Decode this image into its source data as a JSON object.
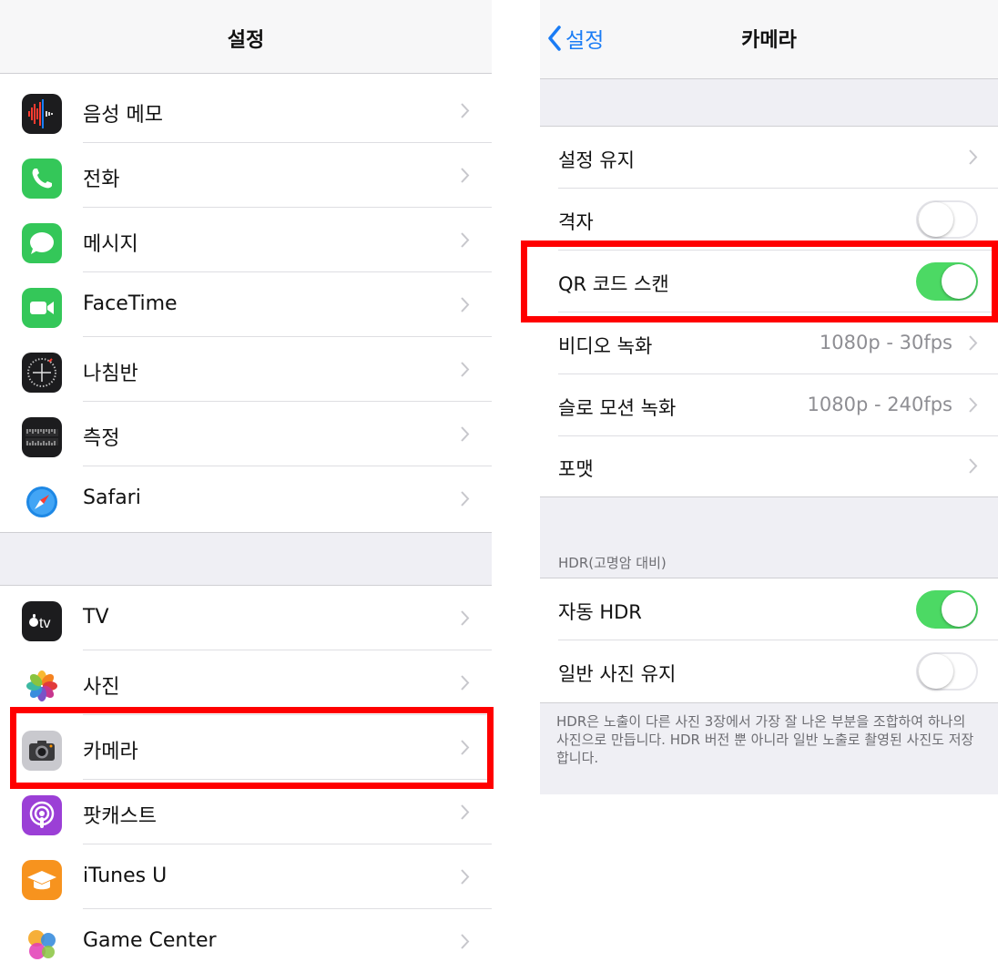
{
  "left": {
    "title": "설정",
    "group1": [
      {
        "label": "음성 메모",
        "icon": "voice-memos-icon"
      },
      {
        "label": "전화",
        "icon": "phone-icon"
      },
      {
        "label": "메시지",
        "icon": "messages-icon"
      },
      {
        "label": "FaceTime",
        "icon": "facetime-icon"
      },
      {
        "label": "나침반",
        "icon": "compass-icon"
      },
      {
        "label": "측정",
        "icon": "measure-icon"
      },
      {
        "label": "Safari",
        "icon": "safari-icon"
      }
    ],
    "group2": [
      {
        "label": "TV",
        "icon": "apple-tv-icon"
      },
      {
        "label": "사진",
        "icon": "photos-icon"
      },
      {
        "label": "카메라",
        "icon": "camera-icon"
      },
      {
        "label": "팟캐스트",
        "icon": "podcasts-icon"
      },
      {
        "label": "iTunes U",
        "icon": "itunes-u-icon"
      },
      {
        "label": "Game Center",
        "icon": "game-center-icon"
      }
    ],
    "tv_icon_text": "tv"
  },
  "right": {
    "back_label": "설정",
    "title": "카메라",
    "rows": {
      "preserve_settings": {
        "label": "설정 유지"
      },
      "grid": {
        "label": "격자",
        "enabled": false
      },
      "scan_qr": {
        "label": "QR 코드 스캔",
        "enabled": true
      },
      "record_video": {
        "label": "비디오 녹화",
        "value": "1080p - 30fps"
      },
      "record_slomo": {
        "label": "슬로 모션 녹화",
        "value": "1080p - 240fps"
      },
      "formats": {
        "label": "포맷"
      }
    },
    "hdr_header": "HDR(고명암 대비)",
    "hdr_rows": {
      "auto_hdr": {
        "label": "자동 HDR",
        "enabled": true
      },
      "keep_normal": {
        "label": "일반 사진 유지",
        "enabled": false
      }
    },
    "hdr_footnote": "HDR은 노출이 다른 사진 3장에서 가장 잘 나온 부분을 조합하여 하나의 사진으로 만듭니다. HDR 버전 뿐 아니라 일반 노출로 촬영된 사진도 저장합니다."
  },
  "colors": {
    "highlight": "#ff0000",
    "toggle_on": "#4cd964",
    "link": "#1a7cf5",
    "grouped_background": "#efeff4"
  }
}
